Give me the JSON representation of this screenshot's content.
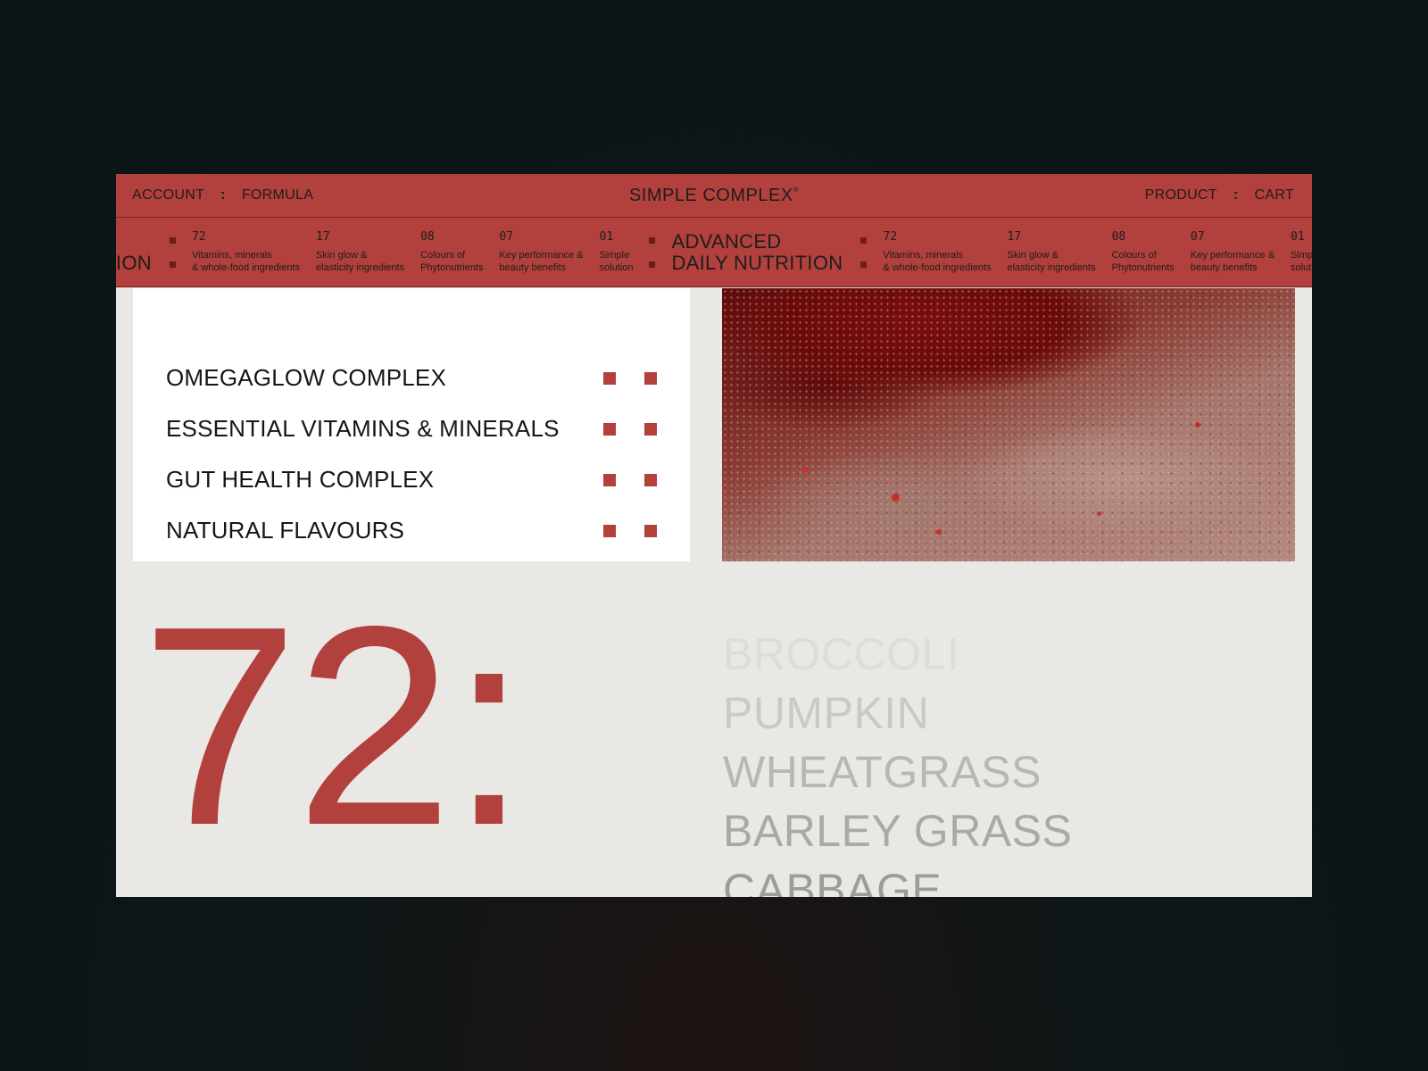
{
  "nav": {
    "account": "ACCOUNT",
    "formula": "FORMULA",
    "brand": "SIMPLE COMPLEX",
    "brand_mark": "®",
    "product": "PRODUCT",
    "cart": "CART",
    "separator": ":"
  },
  "ticker": {
    "title_line1": "ADVANCED",
    "title_line2": "DAILY NUTRITION",
    "stats": [
      {
        "number": "72",
        "caption": "Vitamins, minerals\n& whole-food ingredients"
      },
      {
        "number": "17",
        "caption": "Skin glow &\nelasticity ingredients"
      },
      {
        "number": "08",
        "caption": "Colours of\nPhytonutrients"
      },
      {
        "number": "07",
        "caption": "Key performance &\nbeauty benefits"
      },
      {
        "number": "01",
        "caption": "Simple\nsolution"
      }
    ]
  },
  "ingredients": [
    "OMEGAGLOW COMPLEX",
    "ESSENTIAL VITAMINS & MINERALS",
    "GUT HEALTH COMPLEX",
    "NATURAL FLAVOURS"
  ],
  "hero_number": "72:",
  "vegetables": [
    "BROCCOLI",
    "PUMPKIN",
    "WHEATGRASS",
    "BARLEY GRASS",
    "CABBAGE"
  ],
  "colors": {
    "accent": "#b2403c",
    "page_bg": "#e9e8e4",
    "backdrop": "#0e1718"
  }
}
